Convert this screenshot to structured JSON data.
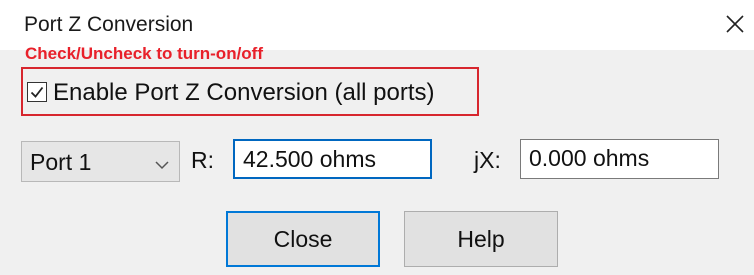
{
  "window": {
    "title": "Port Z Conversion",
    "close_icon": "close-icon"
  },
  "annotation": {
    "text": "Check/Uncheck to turn-on/off",
    "color": "#e8202a",
    "box_color": "#d7262e"
  },
  "enable_conversion": {
    "label": "Enable Port Z Conversion (all ports)",
    "checked": true
  },
  "port_select": {
    "selected": "Port 1"
  },
  "resistance": {
    "label": "R:",
    "value": "42.500 ohms"
  },
  "reactance": {
    "label": "jX:",
    "value": "0.000 ohms"
  },
  "buttons": {
    "close_label": "Close",
    "help_label": "Help"
  },
  "colors": {
    "focus_accent": "#0078d7",
    "dialog_bg": "#f0f0f0"
  }
}
